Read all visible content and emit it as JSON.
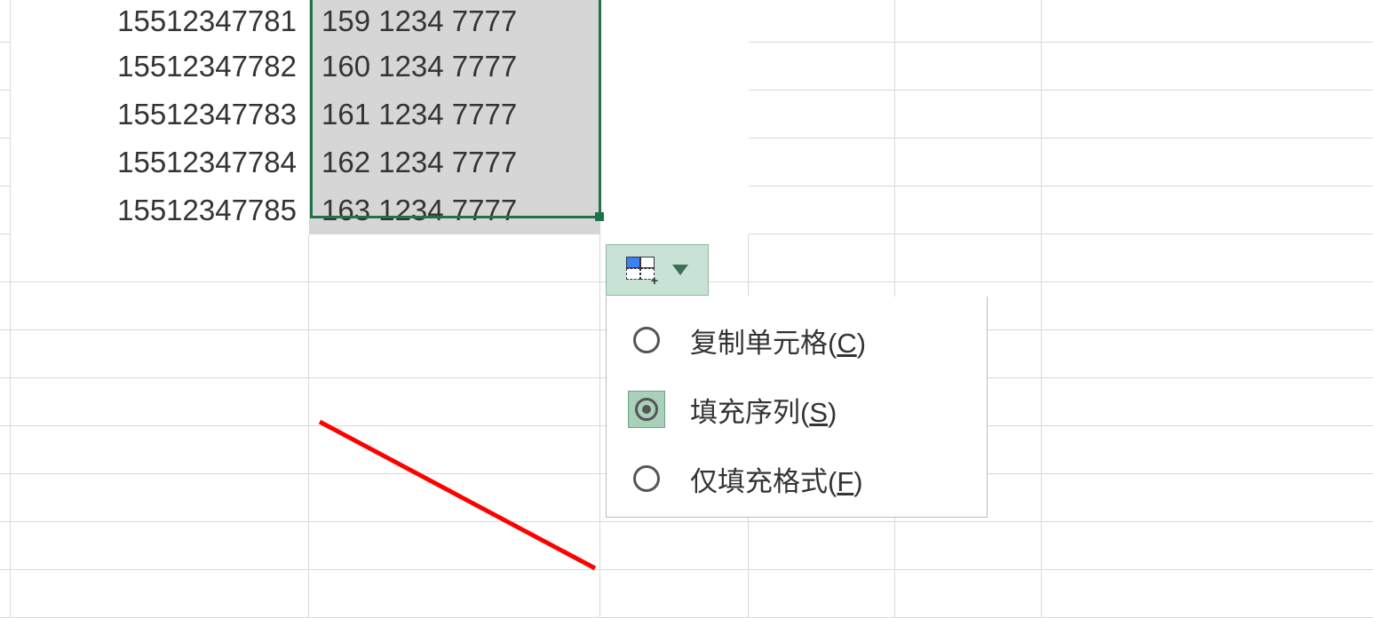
{
  "sheet": {
    "rows": [
      {
        "a": "15512347781",
        "b": "159 1234 7777"
      },
      {
        "a": "15512347782",
        "b": "160 1234 7777"
      },
      {
        "a": "15512347783",
        "b": "161 1234 7777"
      },
      {
        "a": "15512347784",
        "b": "162 1234 7777"
      },
      {
        "a": "15512347785",
        "b": "163 1234 7777"
      }
    ]
  },
  "autofill_menu": {
    "options": [
      {
        "label": "复制单元格(",
        "hotkey": "C",
        "tail": ")",
        "selected": false
      },
      {
        "label": "填充序列(",
        "hotkey": "S",
        "tail": ")",
        "selected": true
      },
      {
        "label": "仅填充格式(",
        "hotkey": "F",
        "tail": ")",
        "selected": false
      }
    ]
  },
  "colors": {
    "selection_border": "#217346",
    "selection_fill": "#d6d6d6",
    "menu_highlight": "#a8d0bb",
    "annotation": "#ff0000"
  }
}
